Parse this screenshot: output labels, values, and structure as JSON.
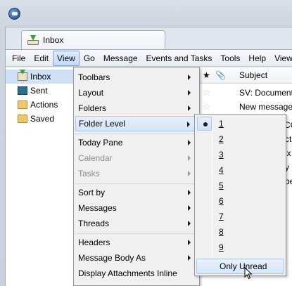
{
  "tab": {
    "title": "Inbox"
  },
  "menubar": {
    "items": [
      {
        "label": "File"
      },
      {
        "label": "Edit"
      },
      {
        "label": "View"
      },
      {
        "label": "Go"
      },
      {
        "label": "Message"
      },
      {
        "label": "Events and Tasks"
      },
      {
        "label": "Tools"
      },
      {
        "label": "Help"
      },
      {
        "label": "View:"
      }
    ]
  },
  "folders": [
    {
      "label": "Inbox"
    },
    {
      "label": "Sent"
    },
    {
      "label": "Actions"
    },
    {
      "label": "Saved"
    }
  ],
  "thread_pane": {
    "subject_header": "Subject",
    "rows": [
      {
        "subject": "SV: Document"
      },
      {
        "subject": "New message"
      }
    ],
    "partial_fragments": [
      "CC",
      "ct",
      "ix",
      "y I",
      "be"
    ]
  },
  "view_menu": {
    "items": [
      {
        "label": "Toolbars"
      },
      {
        "label": "Layout"
      },
      {
        "label": "Folders"
      },
      {
        "label": "Folder Level"
      },
      {
        "label": "Today Pane"
      },
      {
        "label": "Calendar"
      },
      {
        "label": "Tasks"
      },
      {
        "label": "Sort by"
      },
      {
        "label": "Messages"
      },
      {
        "label": "Threads"
      },
      {
        "label": "Headers"
      },
      {
        "label": "Message Body As"
      },
      {
        "label": "Display Attachments Inline"
      }
    ]
  },
  "folder_level_menu": {
    "items": [
      {
        "label": "1"
      },
      {
        "label": "2"
      },
      {
        "label": "3"
      },
      {
        "label": "4"
      },
      {
        "label": "5"
      },
      {
        "label": "6"
      },
      {
        "label": "7"
      },
      {
        "label": "8"
      },
      {
        "label": "9"
      },
      {
        "label": "Only Unread"
      }
    ],
    "selected": "1"
  },
  "colors": {
    "menu_highlight": "#d5e5f7",
    "menu_highlight_border": "#a8c8ec",
    "disabled_text": "#8d8d8d"
  }
}
